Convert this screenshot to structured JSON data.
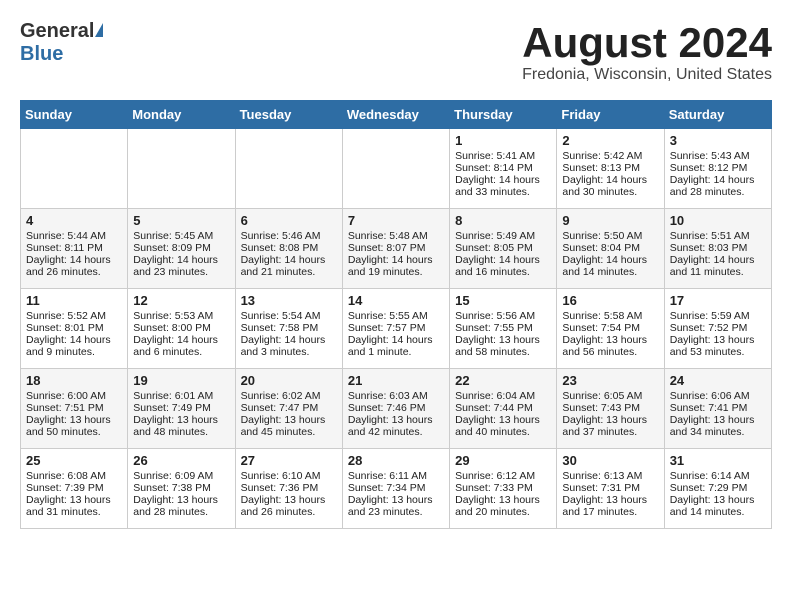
{
  "header": {
    "logo_general": "General",
    "logo_blue": "Blue",
    "month_title": "August 2024",
    "location": "Fredonia, Wisconsin, United States"
  },
  "weekdays": [
    "Sunday",
    "Monday",
    "Tuesday",
    "Wednesday",
    "Thursday",
    "Friday",
    "Saturday"
  ],
  "weeks": [
    [
      {
        "day": "",
        "sunrise": "",
        "sunset": "",
        "daylight": ""
      },
      {
        "day": "",
        "sunrise": "",
        "sunset": "",
        "daylight": ""
      },
      {
        "day": "",
        "sunrise": "",
        "sunset": "",
        "daylight": ""
      },
      {
        "day": "",
        "sunrise": "",
        "sunset": "",
        "daylight": ""
      },
      {
        "day": "1",
        "sunrise": "Sunrise: 5:41 AM",
        "sunset": "Sunset: 8:14 PM",
        "daylight": "Daylight: 14 hours and 33 minutes."
      },
      {
        "day": "2",
        "sunrise": "Sunrise: 5:42 AM",
        "sunset": "Sunset: 8:13 PM",
        "daylight": "Daylight: 14 hours and 30 minutes."
      },
      {
        "day": "3",
        "sunrise": "Sunrise: 5:43 AM",
        "sunset": "Sunset: 8:12 PM",
        "daylight": "Daylight: 14 hours and 28 minutes."
      }
    ],
    [
      {
        "day": "4",
        "sunrise": "Sunrise: 5:44 AM",
        "sunset": "Sunset: 8:11 PM",
        "daylight": "Daylight: 14 hours and 26 minutes."
      },
      {
        "day": "5",
        "sunrise": "Sunrise: 5:45 AM",
        "sunset": "Sunset: 8:09 PM",
        "daylight": "Daylight: 14 hours and 23 minutes."
      },
      {
        "day": "6",
        "sunrise": "Sunrise: 5:46 AM",
        "sunset": "Sunset: 8:08 PM",
        "daylight": "Daylight: 14 hours and 21 minutes."
      },
      {
        "day": "7",
        "sunrise": "Sunrise: 5:48 AM",
        "sunset": "Sunset: 8:07 PM",
        "daylight": "Daylight: 14 hours and 19 minutes."
      },
      {
        "day": "8",
        "sunrise": "Sunrise: 5:49 AM",
        "sunset": "Sunset: 8:05 PM",
        "daylight": "Daylight: 14 hours and 16 minutes."
      },
      {
        "day": "9",
        "sunrise": "Sunrise: 5:50 AM",
        "sunset": "Sunset: 8:04 PM",
        "daylight": "Daylight: 14 hours and 14 minutes."
      },
      {
        "day": "10",
        "sunrise": "Sunrise: 5:51 AM",
        "sunset": "Sunset: 8:03 PM",
        "daylight": "Daylight: 14 hours and 11 minutes."
      }
    ],
    [
      {
        "day": "11",
        "sunrise": "Sunrise: 5:52 AM",
        "sunset": "Sunset: 8:01 PM",
        "daylight": "Daylight: 14 hours and 9 minutes."
      },
      {
        "day": "12",
        "sunrise": "Sunrise: 5:53 AM",
        "sunset": "Sunset: 8:00 PM",
        "daylight": "Daylight: 14 hours and 6 minutes."
      },
      {
        "day": "13",
        "sunrise": "Sunrise: 5:54 AM",
        "sunset": "Sunset: 7:58 PM",
        "daylight": "Daylight: 14 hours and 3 minutes."
      },
      {
        "day": "14",
        "sunrise": "Sunrise: 5:55 AM",
        "sunset": "Sunset: 7:57 PM",
        "daylight": "Daylight: 14 hours and 1 minute."
      },
      {
        "day": "15",
        "sunrise": "Sunrise: 5:56 AM",
        "sunset": "Sunset: 7:55 PM",
        "daylight": "Daylight: 13 hours and 58 minutes."
      },
      {
        "day": "16",
        "sunrise": "Sunrise: 5:58 AM",
        "sunset": "Sunset: 7:54 PM",
        "daylight": "Daylight: 13 hours and 56 minutes."
      },
      {
        "day": "17",
        "sunrise": "Sunrise: 5:59 AM",
        "sunset": "Sunset: 7:52 PM",
        "daylight": "Daylight: 13 hours and 53 minutes."
      }
    ],
    [
      {
        "day": "18",
        "sunrise": "Sunrise: 6:00 AM",
        "sunset": "Sunset: 7:51 PM",
        "daylight": "Daylight: 13 hours and 50 minutes."
      },
      {
        "day": "19",
        "sunrise": "Sunrise: 6:01 AM",
        "sunset": "Sunset: 7:49 PM",
        "daylight": "Daylight: 13 hours and 48 minutes."
      },
      {
        "day": "20",
        "sunrise": "Sunrise: 6:02 AM",
        "sunset": "Sunset: 7:47 PM",
        "daylight": "Daylight: 13 hours and 45 minutes."
      },
      {
        "day": "21",
        "sunrise": "Sunrise: 6:03 AM",
        "sunset": "Sunset: 7:46 PM",
        "daylight": "Daylight: 13 hours and 42 minutes."
      },
      {
        "day": "22",
        "sunrise": "Sunrise: 6:04 AM",
        "sunset": "Sunset: 7:44 PM",
        "daylight": "Daylight: 13 hours and 40 minutes."
      },
      {
        "day": "23",
        "sunrise": "Sunrise: 6:05 AM",
        "sunset": "Sunset: 7:43 PM",
        "daylight": "Daylight: 13 hours and 37 minutes."
      },
      {
        "day": "24",
        "sunrise": "Sunrise: 6:06 AM",
        "sunset": "Sunset: 7:41 PM",
        "daylight": "Daylight: 13 hours and 34 minutes."
      }
    ],
    [
      {
        "day": "25",
        "sunrise": "Sunrise: 6:08 AM",
        "sunset": "Sunset: 7:39 PM",
        "daylight": "Daylight: 13 hours and 31 minutes."
      },
      {
        "day": "26",
        "sunrise": "Sunrise: 6:09 AM",
        "sunset": "Sunset: 7:38 PM",
        "daylight": "Daylight: 13 hours and 28 minutes."
      },
      {
        "day": "27",
        "sunrise": "Sunrise: 6:10 AM",
        "sunset": "Sunset: 7:36 PM",
        "daylight": "Daylight: 13 hours and 26 minutes."
      },
      {
        "day": "28",
        "sunrise": "Sunrise: 6:11 AM",
        "sunset": "Sunset: 7:34 PM",
        "daylight": "Daylight: 13 hours and 23 minutes."
      },
      {
        "day": "29",
        "sunrise": "Sunrise: 6:12 AM",
        "sunset": "Sunset: 7:33 PM",
        "daylight": "Daylight: 13 hours and 20 minutes."
      },
      {
        "day": "30",
        "sunrise": "Sunrise: 6:13 AM",
        "sunset": "Sunset: 7:31 PM",
        "daylight": "Daylight: 13 hours and 17 minutes."
      },
      {
        "day": "31",
        "sunrise": "Sunrise: 6:14 AM",
        "sunset": "Sunset: 7:29 PM",
        "daylight": "Daylight: 13 hours and 14 minutes."
      }
    ]
  ]
}
